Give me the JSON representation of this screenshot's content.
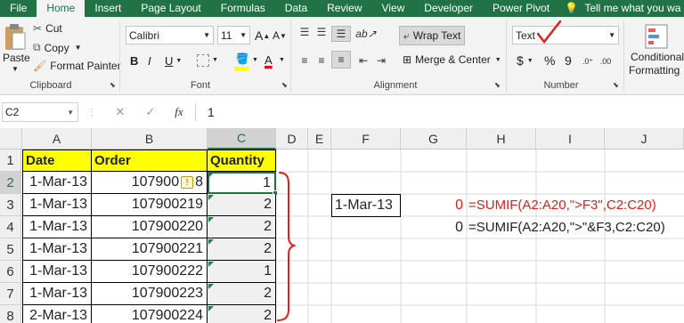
{
  "tabs": [
    "File",
    "Home",
    "Insert",
    "Page Layout",
    "Formulas",
    "Data",
    "Review",
    "View",
    "Developer",
    "Power Pivot"
  ],
  "tell_me": "Tell me what you wa",
  "clipboard": {
    "paste": "Paste",
    "cut": "Cut",
    "copy": "Copy",
    "format_painter": "Format Painter",
    "label": "Clipboard"
  },
  "font": {
    "name": "Calibri",
    "size": "11",
    "bold": "B",
    "italic": "I",
    "underline": "U",
    "grow": "A",
    "shrink": "A",
    "font_color": "A",
    "label": "Font"
  },
  "alignment": {
    "wrap_text": "Wrap Text",
    "merge_center": "Merge & Center",
    "label": "Alignment"
  },
  "number": {
    "format": "Text",
    "currency": "$",
    "percent": "%",
    "comma": "9",
    "label": "Number"
  },
  "styles": {
    "conditional_formatting_1": "Conditional",
    "conditional_formatting_2": "Formatting"
  },
  "formula_bar": {
    "name_box": "C2",
    "cancel": "✕",
    "enter": "✓",
    "fx": "fx",
    "content": "1"
  },
  "columns": [
    "A",
    "B",
    "C",
    "D",
    "E",
    "F",
    "G",
    "H",
    "I",
    "J"
  ],
  "rows": [
    "1",
    "2",
    "3",
    "4",
    "5",
    "6",
    "7",
    "8"
  ],
  "headers": {
    "date": "Date",
    "order": "Order",
    "quantity": "Quantity"
  },
  "data_rows": [
    {
      "date": "1-Mar-13",
      "order": "107900",
      "order_tail": "8",
      "qty": "1"
    },
    {
      "date": "1-Mar-13",
      "order": "107900219",
      "qty": "2"
    },
    {
      "date": "1-Mar-13",
      "order": "107900220",
      "qty": "2"
    },
    {
      "date": "1-Mar-13",
      "order": "107900221",
      "qty": "2"
    },
    {
      "date": "1-Mar-13",
      "order": "107900222",
      "qty": "1"
    },
    {
      "date": "1-Mar-13",
      "order": "107900223",
      "qty": "2"
    },
    {
      "date": "2-Mar-13",
      "order": "107900224",
      "qty": "2"
    }
  ],
  "f3": "1-Mar-13",
  "g3": "0",
  "h3": "=SUMIF(A2:A20,\">F3\",C2:C20)",
  "g4": "0",
  "h4": "=SUMIF(A2:A20,\">\"&F3,C2:C20)",
  "colors": {
    "excel_green": "#217346",
    "highlight_yellow": "#ffff00",
    "annotation_red": "#e0201a"
  }
}
